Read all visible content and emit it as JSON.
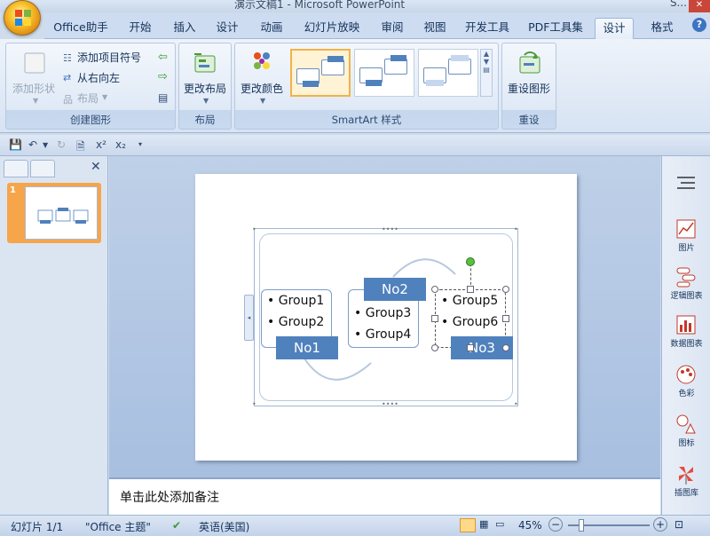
{
  "window": {
    "title": "演示文稿1 - Microsoft PowerPoint",
    "right_fragment": "S..."
  },
  "tabs": [
    {
      "label": "Office助手"
    },
    {
      "label": "开始"
    },
    {
      "label": "插入"
    },
    {
      "label": "设计"
    },
    {
      "label": "动画"
    },
    {
      "label": "幻灯片放映"
    },
    {
      "label": "审阅"
    },
    {
      "label": "视图"
    },
    {
      "label": "开发工具"
    },
    {
      "label": "PDF工具集"
    },
    {
      "label": "设计",
      "active": true
    },
    {
      "label": "格式"
    }
  ],
  "ribbon": {
    "create_graphic": {
      "label": "创建图形",
      "add_shape": "添加形状",
      "add_bullet": "添加项目符号",
      "right_to_left": "从右向左",
      "layout": "布局"
    },
    "layout_group": {
      "label": "布局",
      "change_layout": "更改布局"
    },
    "styles_group": {
      "label": "SmartArt 样式",
      "change_colors": "更改颜色"
    },
    "reset_group": {
      "label": "重设",
      "reset_graphic": "重设图形"
    }
  },
  "qat": {
    "superscript": "x²",
    "subscript": "x₂"
  },
  "slides_pane": {
    "slide_number": "1"
  },
  "smartart": {
    "groups": [
      {
        "items": [
          "Group1",
          "Group2"
        ],
        "label": "No1"
      },
      {
        "items": [
          "Group3",
          "Group4"
        ],
        "label": "No2"
      },
      {
        "items": [
          "Group5",
          "Group6"
        ],
        "label": "No3"
      }
    ]
  },
  "notes": {
    "placeholder": "单击此处添加备注"
  },
  "right_panel": [
    {
      "label": "图片",
      "icon": "chart-icon"
    },
    {
      "label": "逻辑图表",
      "icon": "logic-diagram-icon"
    },
    {
      "label": "数据图表",
      "icon": "data-chart-icon"
    },
    {
      "label": "色彩",
      "icon": "palette-icon"
    },
    {
      "label": "图标",
      "icon": "shapes-icon"
    },
    {
      "label": "插图库",
      "icon": "clipart-icon"
    }
  ],
  "status": {
    "slide_info": "幻灯片 1/1",
    "theme": "\"Office 主题\"",
    "language": "英语(美国)",
    "zoom": "45%"
  },
  "colors": {
    "accent": "#4f81bd",
    "selected_tab": "#e6eefa"
  }
}
